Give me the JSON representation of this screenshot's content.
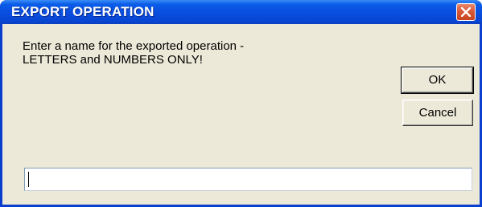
{
  "window": {
    "title": "EXPORT OPERATION"
  },
  "titlebar": {
    "close_icon": "close-icon",
    "close_color": "#d95a36"
  },
  "message": {
    "line1": "Enter a name for the exported operation -",
    "line2": "LETTERS and NUMBERS ONLY!"
  },
  "buttons": {
    "ok_label": "OK",
    "cancel_label": "Cancel"
  },
  "input": {
    "value": ""
  },
  "colors": {
    "titlebar": "#0a4fe0",
    "dialog_background": "#ece9d8"
  }
}
